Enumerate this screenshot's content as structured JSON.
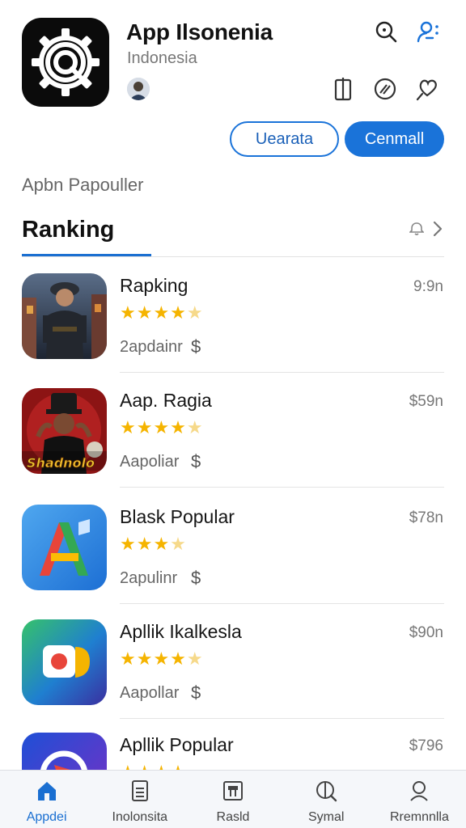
{
  "header": {
    "title": "App Ilsonenia",
    "subtitle": "Indonesia",
    "search_icon": "search-icon",
    "person_search_icon": "person-search-icon",
    "actions": [
      "bookmark-icon",
      "slash-circle-icon",
      "heart-icon"
    ]
  },
  "buttons": {
    "outline_label": "Uearata",
    "primary_label": "Cenmall"
  },
  "section": {
    "subtitle": "Apbn Papouller",
    "tab_title": "Ranking"
  },
  "apps": [
    {
      "name": "Rapking",
      "stars": 4.5,
      "stars_text": "★★★★",
      "half": "★",
      "meta": "2apdainr",
      "currency": "$",
      "price": "9:9n",
      "thumb": "soldier-game-thumb"
    },
    {
      "name": "Aap. Ragia",
      "stars": 4.5,
      "stars_text": "★★★★",
      "half": "★",
      "meta": "Aapoliar",
      "currency": "$",
      "price": "$59n",
      "thumb": "shadow-game-thumb",
      "thumb_text": "Shadnolo"
    },
    {
      "name": "Blask Popular",
      "stars": 3.5,
      "stars_text": "★★★",
      "half": "★",
      "meta": "2apulinr",
      "currency": "$",
      "price": "$78n",
      "thumb": "letter-a-thumb"
    },
    {
      "name": "Apllik Ikalkesla",
      "stars": 4.5,
      "stars_text": "★★★★",
      "half": "★",
      "meta": "Aapollar",
      "currency": "$",
      "price": "$90n",
      "thumb": "camera-thumb"
    },
    {
      "name": "Apllik Popular",
      "stars": 4,
      "stars_text": "★★★★",
      "half": "",
      "meta": "",
      "currency": "",
      "price": "$796",
      "thumb": "circle-thumb"
    }
  ],
  "tabbar": [
    {
      "label": "Appdei",
      "icon": "home-icon",
      "active": true
    },
    {
      "label": "Inolonsita",
      "icon": "document-icon",
      "active": false
    },
    {
      "label": "Rasld",
      "icon": "chart-icon",
      "active": false
    },
    {
      "label": "Symal",
      "icon": "search-circle-icon",
      "active": false
    },
    {
      "label": "Rremnnlla",
      "icon": "profile-search-icon",
      "active": false
    }
  ],
  "colors": {
    "accent": "#1a73d9",
    "star": "#f5b400"
  }
}
